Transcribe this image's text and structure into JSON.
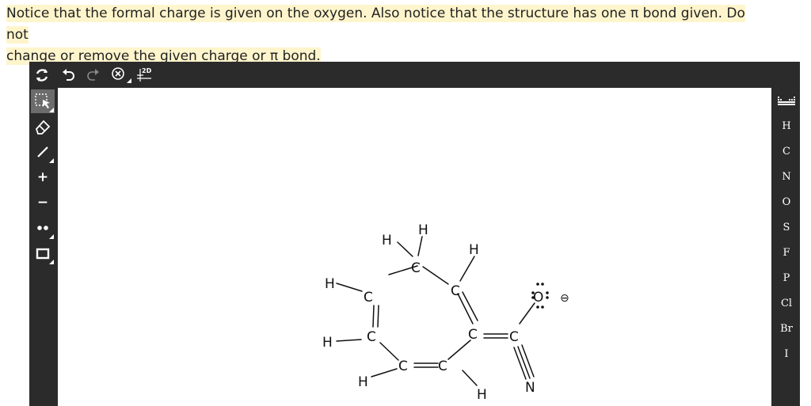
{
  "instruction": {
    "text_line1": "Notice that the formal charge is given on the oxygen. Also notice that the structure has one π  bond given. Do not",
    "text_line2": "change or remove the given charge or π  bond."
  },
  "toolbar_top": [
    {
      "name": "clear-icon"
    },
    {
      "name": "undo-icon"
    },
    {
      "name": "redo-icon"
    },
    {
      "name": "zoom-icon"
    },
    {
      "name": "2d-clean-icon",
      "label": "2D"
    }
  ],
  "toolbar_left": [
    {
      "name": "select-tool-icon"
    },
    {
      "name": "eraser-tool-icon"
    },
    {
      "name": "bond-tool-icon"
    },
    {
      "name": "positive-charge-tool-icon",
      "label": "+"
    },
    {
      "name": "negative-charge-tool-icon",
      "label": "−"
    },
    {
      "name": "lone-pair-tool-icon"
    },
    {
      "name": "rectangle-tool-icon"
    }
  ],
  "toolbar_right": {
    "periodic_table_icon": "periodic-table-icon",
    "elements": [
      "H",
      "C",
      "N",
      "O",
      "S",
      "F",
      "P",
      "Cl",
      "Br",
      "I"
    ]
  },
  "molecule": {
    "atoms": {
      "C1": "C",
      "C2": "C",
      "C3": "C",
      "C4": "C",
      "C5": "C",
      "C6": "C",
      "C7": "C",
      "C8": "C",
      "O": "O",
      "N": "N",
      "H1": "H",
      "H2": "H",
      "H3": "H",
      "H4": "H",
      "H5": "H",
      "H6": "H",
      "H7": "H"
    },
    "charge": "⊖"
  }
}
